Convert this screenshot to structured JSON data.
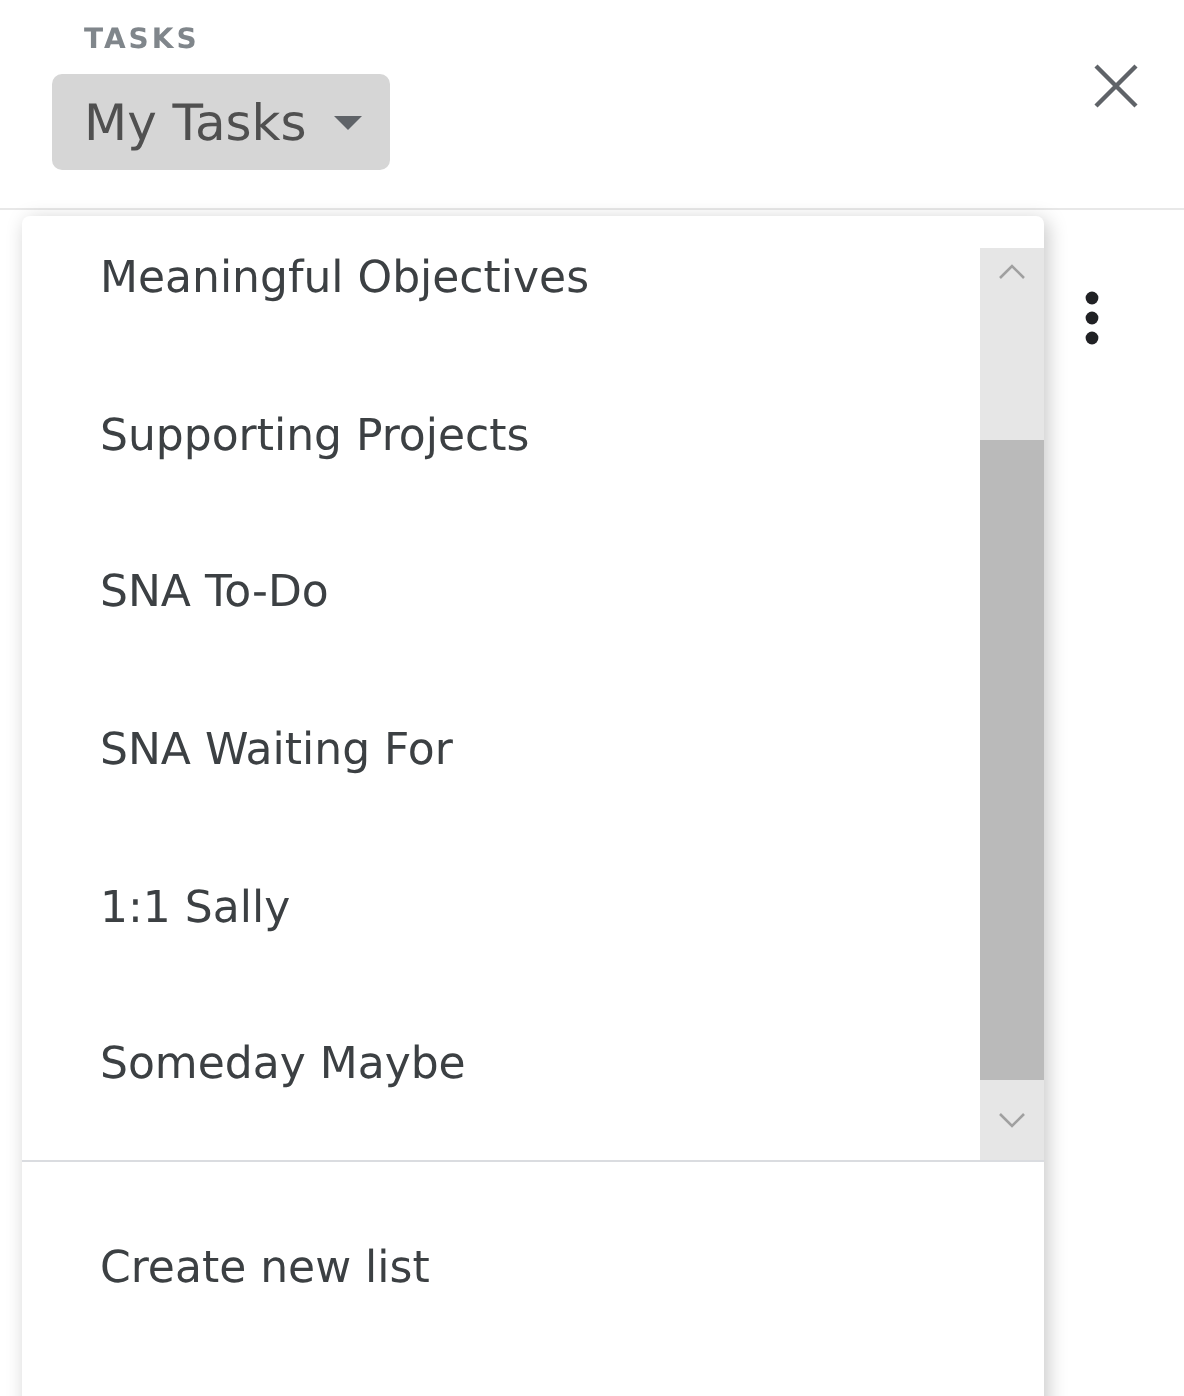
{
  "header": {
    "label": "TASKS",
    "list_button": "My Tasks"
  },
  "menu": {
    "items": [
      {
        "label": "Meaningful Objectives"
      },
      {
        "label": "Supporting Projects"
      },
      {
        "label": "SNA To-Do"
      },
      {
        "label": "SNA Waiting For"
      },
      {
        "label": "1:1 Sally"
      },
      {
        "label": "Someday Maybe"
      }
    ],
    "action": "Create new list"
  }
}
